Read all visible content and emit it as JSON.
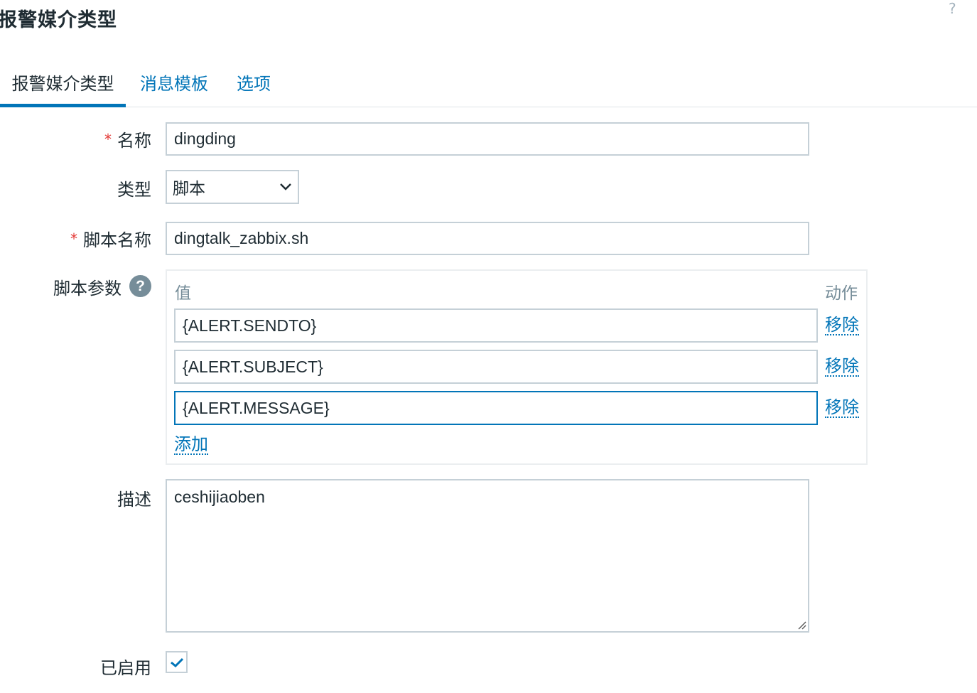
{
  "page": {
    "title": "报警媒介类型",
    "help_symbol": "?"
  },
  "tabs": [
    "报警媒介类型",
    "消息模板",
    "选项"
  ],
  "form": {
    "required_mark": "*",
    "name_label": "名称",
    "name_value": "dingding",
    "type_label": "类型",
    "type_value": "脚本",
    "script_name_label": "脚本名称",
    "script_name_value": "dingtalk_zabbix.sh",
    "script_params_label": "脚本参数",
    "help_symbol": "?",
    "params": {
      "value_header": "值",
      "action_header": "动作",
      "rows": [
        {
          "value": "{ALERT.SENDTO}",
          "action": "移除"
        },
        {
          "value": "{ALERT.SUBJECT}",
          "action": "移除"
        },
        {
          "value": "{ALERT.MESSAGE}",
          "action": "移除"
        }
      ],
      "add_label": "添加"
    },
    "description_label": "描述",
    "description_value": "ceshijiaoben",
    "enabled_label": "已启用",
    "enabled_checked": true
  },
  "colors": {
    "accent": "#0275b8",
    "text": "#1f2c33",
    "required": "#e33734",
    "border": "#c5d0d7",
    "muted": "#768d99"
  }
}
